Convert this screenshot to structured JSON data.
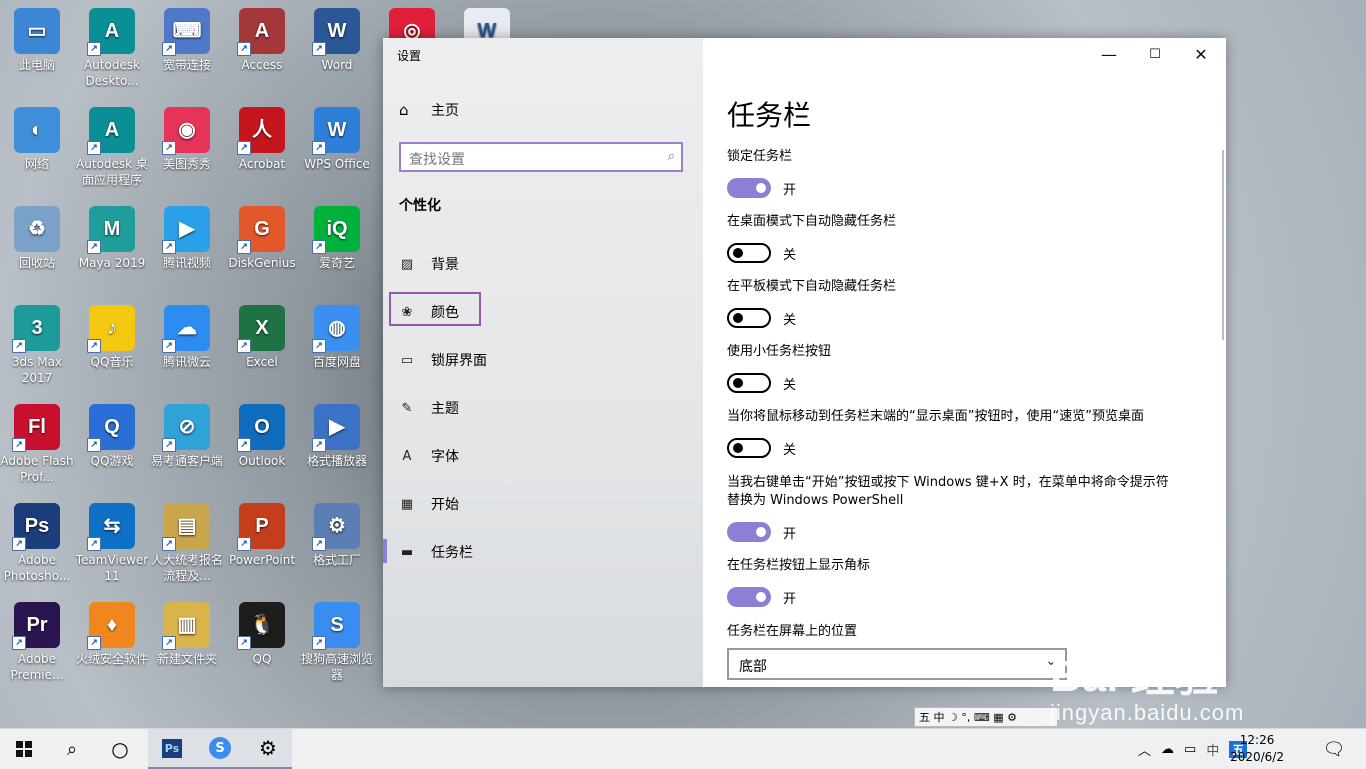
{
  "desktop": {
    "icons": [
      {
        "label": "此电脑",
        "color": "#3d86d6",
        "glyph": "▭"
      },
      {
        "label": "Autodesk Deskto...",
        "color": "#0b8f96",
        "glyph": "A"
      },
      {
        "label": "宽带连接",
        "color": "#4f78c8",
        "glyph": "⌨"
      },
      {
        "label": "Access",
        "color": "#a4373a",
        "glyph": "A"
      },
      {
        "label": "Word",
        "color": "#2b5797",
        "glyph": "W"
      },
      {
        "label": "网络",
        "color": "#3f8ed8",
        "glyph": "◐"
      },
      {
        "label": "Autodesk 桌面应用程序",
        "color": "#0b8f96",
        "glyph": "A"
      },
      {
        "label": "美图秀秀",
        "color": "#e5335a",
        "glyph": "◉"
      },
      {
        "label": "Acrobat",
        "color": "#c4161c",
        "glyph": "人"
      },
      {
        "label": "WPS Office",
        "color": "#2d7fd8",
        "glyph": "W"
      },
      {
        "label": "回收站",
        "color": "#7aa2c9",
        "glyph": "♻"
      },
      {
        "label": "Maya 2019",
        "color": "#1e9d9a",
        "glyph": "M"
      },
      {
        "label": "腾讯视频",
        "color": "#2aa0e8",
        "glyph": "▶"
      },
      {
        "label": "DiskGenius",
        "color": "#e2582a",
        "glyph": "G"
      },
      {
        "label": "爱奇艺",
        "color": "#00b23c",
        "glyph": "iQ"
      },
      {
        "label": "3ds Max 2017",
        "color": "#1d9a9a",
        "glyph": "3"
      },
      {
        "label": "QQ音乐",
        "color": "#f2c811",
        "glyph": "♪"
      },
      {
        "label": "腾讯微云",
        "color": "#2d8cf0",
        "glyph": "☁"
      },
      {
        "label": "Excel",
        "color": "#1f7244",
        "glyph": "X"
      },
      {
        "label": "百度网盘",
        "color": "#3b8ff0",
        "glyph": "◍"
      },
      {
        "label": "Adobe Flash Prof...",
        "color": "#c8102e",
        "glyph": "Fl"
      },
      {
        "label": "QQ游戏",
        "color": "#2a6fd6",
        "glyph": "Q"
      },
      {
        "label": "易考通客户端",
        "color": "#2fa3d8",
        "glyph": "⊘"
      },
      {
        "label": "Outlook",
        "color": "#0f6cbd",
        "glyph": "O"
      },
      {
        "label": "格式播放器",
        "color": "#3a72c6",
        "glyph": "▶"
      },
      {
        "label": "Adobe Photosho...",
        "color": "#1b3f7a",
        "glyph": "Ps"
      },
      {
        "label": "TeamViewer 11",
        "color": "#0e71c6",
        "glyph": "⇆"
      },
      {
        "label": "人大统考报名流程及...",
        "color": "#c9a64c",
        "glyph": "▤"
      },
      {
        "label": "PowerPoint",
        "color": "#c43e1c",
        "glyph": "P"
      },
      {
        "label": "格式工厂",
        "color": "#5b7fb5",
        "glyph": "⚙"
      },
      {
        "label": "Adobe Premie...",
        "color": "#2a1550",
        "glyph": "Pr"
      },
      {
        "label": "火绒安全软件",
        "color": "#f0871e",
        "glyph": "♦"
      },
      {
        "label": "新建文件夹",
        "color": "#d9b44a",
        "glyph": "▥"
      },
      {
        "label": "QQ",
        "color": "#1d1d1d",
        "glyph": "🐧"
      },
      {
        "label": "搜狗高速浏览器",
        "color": "#3a8df0",
        "glyph": "S"
      }
    ],
    "partial_icons": [
      {
        "label": "",
        "color": "#e0203a",
        "glyph": "◎"
      },
      {
        "label": "",
        "color": "#e8ecf2",
        "glyph": "W"
      }
    ]
  },
  "window": {
    "title": "设置",
    "controls": {
      "minimize": "—",
      "maximize": "☐",
      "close": "✕"
    },
    "nav": {
      "home": "主页",
      "search_placeholder": "查找设置",
      "section": "个性化",
      "items": [
        {
          "label": "背景",
          "icon": "image-icon",
          "glyph": "▨"
        },
        {
          "label": "颜色",
          "icon": "palette-icon",
          "glyph": "❀"
        },
        {
          "label": "锁屏界面",
          "icon": "lock-screen-icon",
          "glyph": "▭"
        },
        {
          "label": "主题",
          "icon": "theme-icon",
          "glyph": "✎"
        },
        {
          "label": "字体",
          "icon": "font-icon",
          "glyph": "A"
        },
        {
          "label": "开始",
          "icon": "start-icon",
          "glyph": "▦"
        },
        {
          "label": "任务栏",
          "icon": "taskbar-icon",
          "glyph": "▬"
        }
      ]
    },
    "page": {
      "title": "任务栏",
      "settings": [
        {
          "label": "锁定任务栏",
          "state": "on",
          "state_text": "开"
        },
        {
          "label": "在桌面模式下自动隐藏任务栏",
          "state": "off",
          "state_text": "关"
        },
        {
          "label": "在平板模式下自动隐藏任务栏",
          "state": "off",
          "state_text": "关"
        },
        {
          "label": "使用小任务栏按钮",
          "state": "off",
          "state_text": "关"
        },
        {
          "label": "当你将鼠标移动到任务栏末端的“显示桌面”按钮时，使用“速览”预览桌面",
          "state": "off",
          "state_text": "关"
        },
        {
          "label": "当我右键单击“开始”按钮或按下 Windows 键+X 时，在菜单中将命令提示符替换为 Windows PowerShell",
          "state": "on",
          "state_text": "开"
        },
        {
          "label": "在任务栏按钮上显示角标",
          "state": "on",
          "state_text": "开"
        }
      ],
      "position_label": "任务栏在屏幕上的位置",
      "position_value": "底部"
    }
  },
  "taskbar": {
    "time": "12:26",
    "date": "2020/6/2",
    "ime_lang": "中",
    "ime_mode": "五",
    "ime_bar": "五 中 ☽ °, ⌨ ▦ ⚙"
  },
  "watermark": {
    "big": "Bai 经验",
    "small": "jingyan.baidu.com"
  },
  "colors": {
    "accent": "#8c80d6",
    "highlight": "#9a55b4"
  }
}
